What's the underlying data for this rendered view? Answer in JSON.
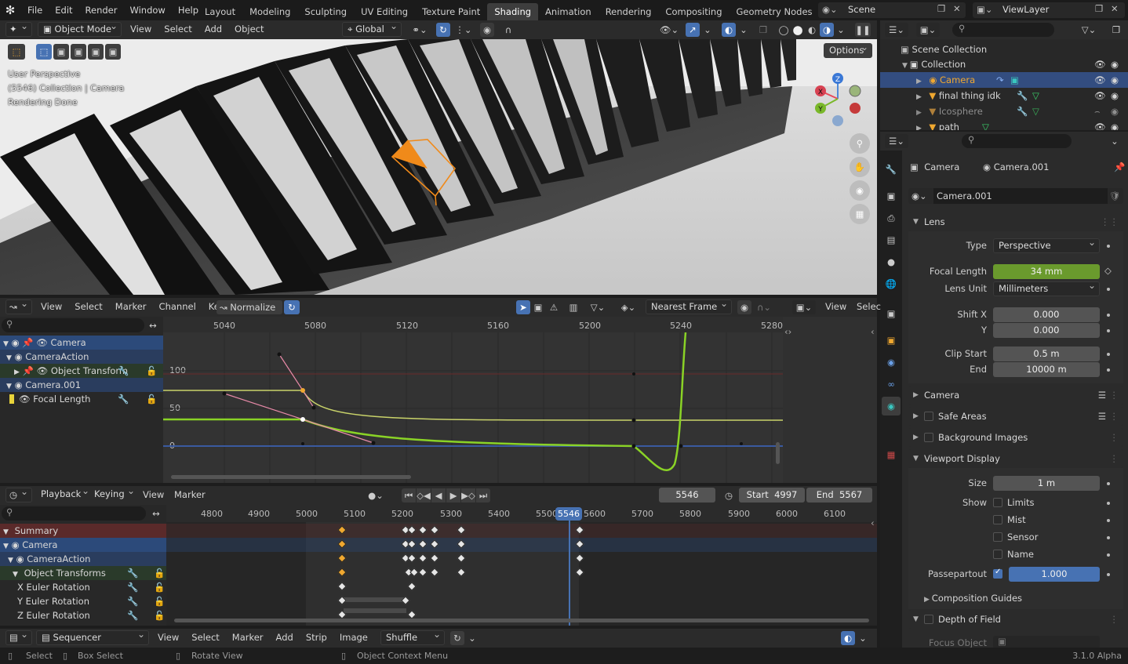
{
  "topbar": {
    "menus": [
      "File",
      "Edit",
      "Render",
      "Window",
      "Help"
    ],
    "workspaces": [
      "Layout",
      "Modeling",
      "Sculpting",
      "UV Editing",
      "Texture Paint",
      "Shading",
      "Animation",
      "Rendering",
      "Compositing",
      "Geometry Nodes"
    ],
    "active_workspace": "Shading",
    "scene": "Scene",
    "view_layer": "ViewLayer"
  },
  "viewport": {
    "mode": "Object Mode",
    "menus": [
      "View",
      "Select",
      "Add",
      "Object"
    ],
    "transform_orientation": "Global",
    "options": "Options",
    "overlay_lines": [
      "User Perspective",
      "(5546) Collection | Camera",
      "Rendering Done"
    ],
    "gizmo": {
      "z": "Z",
      "x": "X",
      "y": "Y"
    }
  },
  "outliner": {
    "scene_collection": "Scene Collection",
    "collection": "Collection",
    "items": [
      "Camera",
      "final thing idk",
      "Icosphere",
      "path"
    ]
  },
  "properties": {
    "breadcrumb_object": "Camera",
    "breadcrumb_data": "Camera.001",
    "datablock": "Camera.001",
    "lens_panel": "Lens",
    "type_label": "Type",
    "type_value": "Perspective",
    "focal_label": "Focal Length",
    "focal_value": "34 mm",
    "lens_unit_label": "Lens Unit",
    "lens_unit_value": "Millimeters",
    "shift_x_label": "Shift X",
    "shift_x_value": "0.000",
    "shift_y_label": "Y",
    "shift_y_value": "0.000",
    "clip_start_label": "Clip Start",
    "clip_start_value": "0.5 m",
    "clip_end_label": "End",
    "clip_end_value": "10000 m",
    "camera_panel": "Camera",
    "safe_areas_panel": "Safe Areas",
    "background_images_panel": "Background Images",
    "viewport_display_panel": "Viewport Display",
    "size_label": "Size",
    "size_value": "1 m",
    "show_label": "Show",
    "show_options": [
      "Limits",
      "Mist",
      "Sensor",
      "Name"
    ],
    "passepartout_label": "Passepartout",
    "passepartout_value": "1.000",
    "composition_guides": "Composition Guides",
    "depth_of_field_panel": "Depth of Field",
    "focus_object_label": "Focus Object"
  },
  "graph_editor": {
    "menus": [
      "View",
      "Select",
      "Marker",
      "Channel",
      "Key"
    ],
    "normalize": "Normalize",
    "snapping": "Nearest Frame",
    "right_menus": [
      "View",
      "Selec"
    ],
    "frame_ticks": [
      "5040",
      "5080",
      "5120",
      "5160",
      "5200",
      "5240",
      "5280"
    ],
    "value_ticks": [
      "100",
      "50",
      "0"
    ],
    "channels": [
      "Camera",
      "CameraAction",
      "Object Transform",
      "Camera.001",
      "Focal Length"
    ]
  },
  "timeline": {
    "menus": [
      "Playback",
      "Keying",
      "View",
      "Marker"
    ],
    "current_frame": "5546",
    "start_label": "Start",
    "start": "4997",
    "end_label": "End",
    "end": "5567",
    "frame_ticks": [
      "4800",
      "4900",
      "5000",
      "5100",
      "5200",
      "5300",
      "5400",
      "5500",
      "5600",
      "5700",
      "5800",
      "5900",
      "6000",
      "6100"
    ],
    "channels": [
      "Summary",
      "Camera",
      "CameraAction",
      "Object Transforms",
      "X Euler Rotation",
      "Y Euler Rotation",
      "Z Euler Rotation"
    ]
  },
  "sequencer": {
    "editor": "Sequencer",
    "menus": [
      "View",
      "Select",
      "Marker",
      "Add",
      "Strip",
      "Image"
    ],
    "mode": "Shuffle"
  },
  "statusbar": {
    "select": "Select",
    "box_select": "Box Select",
    "rotate_view": "Rotate View",
    "context_menu": "Object Context Menu",
    "version": "3.1.0 Alpha"
  },
  "colors": {
    "accent_blue": "#4772b3",
    "focal_green": "#6a9a2d",
    "curve_green": "#8ad326",
    "curve_yellow": "#c9d36a",
    "selection_orange": "#f0a830",
    "summary_red": "#5a2a2a"
  }
}
